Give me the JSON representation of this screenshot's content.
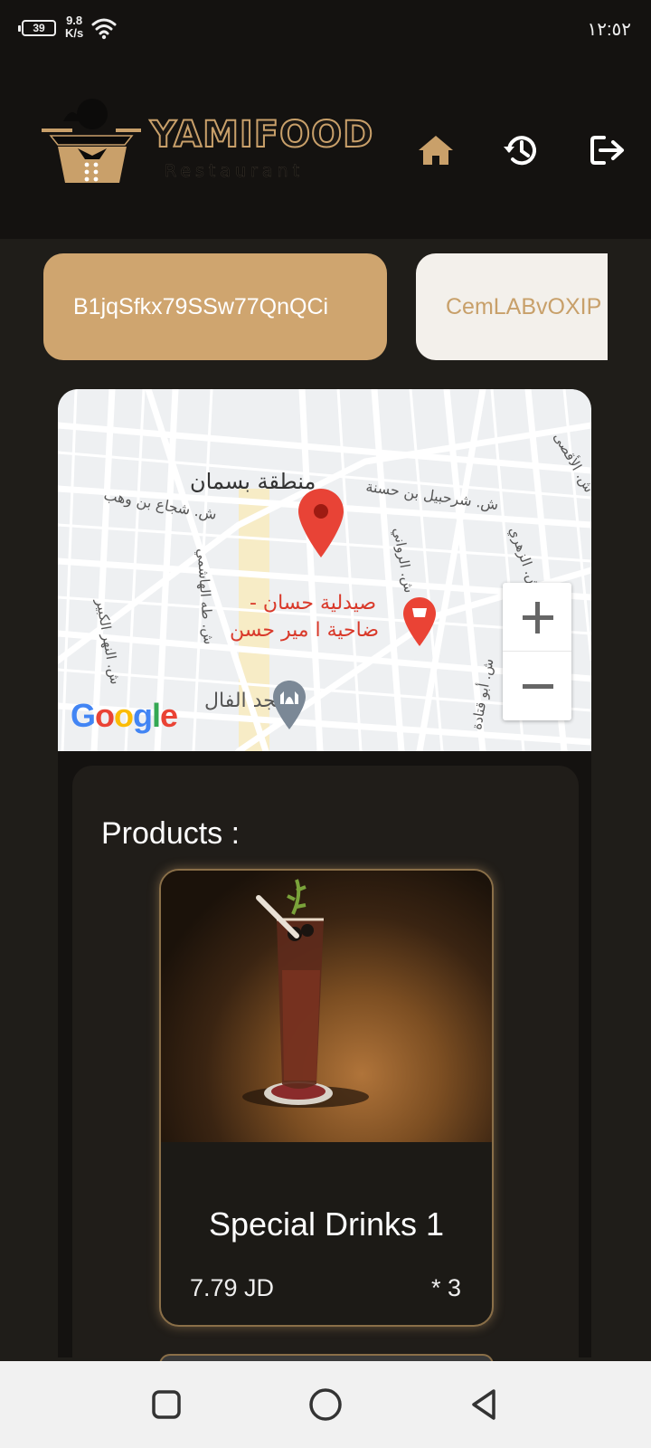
{
  "status_bar": {
    "battery": "39",
    "net_speed_value": "9.8",
    "net_speed_unit": "K/s",
    "time": "١٢:٥٢"
  },
  "header": {
    "logo_title": "YAMIFOOD",
    "logo_subtitle": "Restaurant",
    "icons": [
      "home-icon",
      "history-icon",
      "logout-icon"
    ],
    "accent_color": "#c9a06a"
  },
  "tabs": [
    {
      "label": "B1jqSfkx79SSw77QnQCi",
      "active": true
    },
    {
      "label": "CemLABvOXIP",
      "active": false
    }
  ],
  "map": {
    "labels": {
      "district": "منطقة بسمان",
      "street1": "ش. شجاع بن وهب",
      "street2": "ش. شرحبيل بن حسنة",
      "street3": "ش. الرواني",
      "street4": "ش. طه الهاشمي",
      "street5": "ش. النهر الكبير",
      "street6": "ش. الأقصى",
      "street7": "ش. الزهري",
      "street8": "ش. أبو قتادة",
      "pharmacy_line1": "صيدلية حسان -",
      "pharmacy_line2": "ضاحية ا مير حسن",
      "mosque": "مسجد الفال"
    },
    "zoom_in": "+",
    "zoom_out": "−",
    "attribution": "Google"
  },
  "products": {
    "title": "Products :",
    "items": [
      {
        "name": "Special Drinks 1",
        "price": "7.79 JD",
        "quantity": "* 3"
      }
    ]
  },
  "navbar": {
    "icons": [
      "recent-apps-icon",
      "home-circle-icon",
      "back-icon"
    ]
  }
}
